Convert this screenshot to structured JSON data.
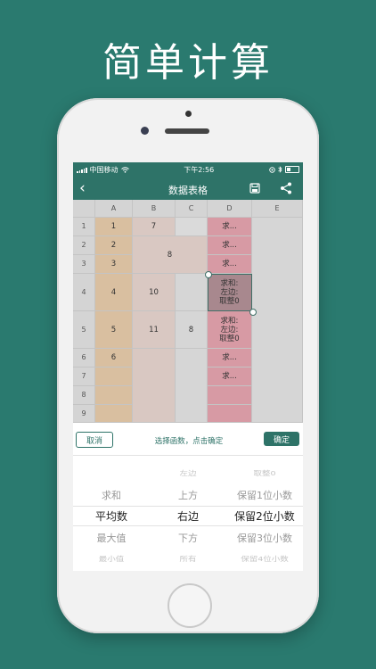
{
  "hero_title": "简单计算",
  "status": {
    "carrier": "中国移动",
    "time": "下午2:56"
  },
  "nav": {
    "title": "数据表格",
    "back_glyph": "‹"
  },
  "sheet": {
    "columns": [
      "A",
      "B",
      "C",
      "D",
      "E"
    ],
    "rows": [
      "1",
      "2",
      "3",
      "4",
      "5",
      "6",
      "7",
      "8",
      "9"
    ],
    "cells": {
      "A1": "1",
      "A2": "2",
      "A3": "3",
      "A4": "4",
      "A5": "5",
      "A6": "6",
      "B1": "7",
      "B2_C3": "8",
      "B4": "10",
      "B5": "11",
      "C5": "8",
      "D1": "求...",
      "D2": "求...",
      "D3": "求...",
      "D4": "求和:\n左边:\n取整0",
      "D5": "求和:\n左边:\n取整0",
      "D6": "求...",
      "D7": "求..."
    }
  },
  "toolbar": {
    "cancel_label": "取消",
    "hint": "选择函数，点击确定",
    "ok_label": "确定"
  },
  "picker": {
    "col1": [
      "求和",
      "平均数",
      "最大值",
      "最小值"
    ],
    "col2": [
      "左边",
      "上方",
      "右边",
      "下方",
      "所有"
    ],
    "col3": [
      "取整0",
      "保留1位小数",
      "保留2位小数",
      "保留3位小数",
      "保留4位小数"
    ],
    "selected": {
      "col1": 1,
      "col2": 2,
      "col3": 2
    }
  },
  "colors": {
    "background": "#2a7a6f",
    "accent": "#2e7368",
    "col_a": "#d9bfa0",
    "col_d": "#d79aa4"
  }
}
